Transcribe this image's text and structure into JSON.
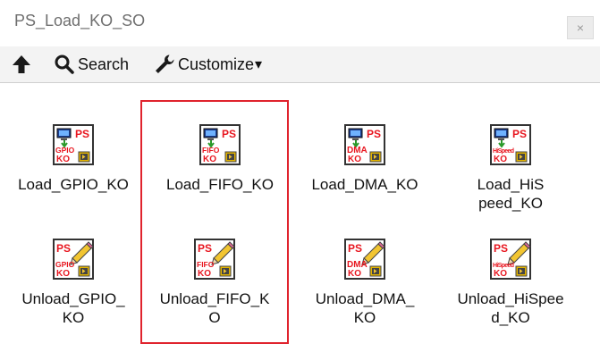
{
  "window": {
    "title": "PS_Load_KO_SO",
    "close_label": "×"
  },
  "toolbar": {
    "up_icon": "arrow-up-icon",
    "search_label": "Search",
    "customize_label": "Customize",
    "customize_arrow": "▾"
  },
  "items": [
    {
      "label": "Load_GPIO_KO",
      "icon_text": "GPIO",
      "kind": "load"
    },
    {
      "label": "Load_FIFO_KO",
      "icon_text": "FIFO",
      "kind": "load"
    },
    {
      "label": "Load_DMA_KO",
      "icon_text": "DMA",
      "kind": "load"
    },
    {
      "label": "Load_HiSpeed_KO",
      "icon_text": "HiSpeed",
      "kind": "load"
    },
    {
      "label": "Unload_GPIO_KO",
      "icon_text": "GPIO",
      "kind": "unload"
    },
    {
      "label": "Unload_FIFO_KO",
      "icon_text": "FIFO",
      "kind": "unload"
    },
    {
      "label": "Unload_DMA_KO",
      "icon_text": "DMA",
      "kind": "unload"
    },
    {
      "label": "Unload_HiSpeed_KO",
      "icon_text": "HiSpeed",
      "kind": "unload"
    }
  ],
  "icon_text": {
    "ps": "PS",
    "ko": "KO"
  },
  "colors": {
    "highlight_border": "#e0232d",
    "icon_red": "#e8161f",
    "icon_green": "#2a9a2a"
  }
}
